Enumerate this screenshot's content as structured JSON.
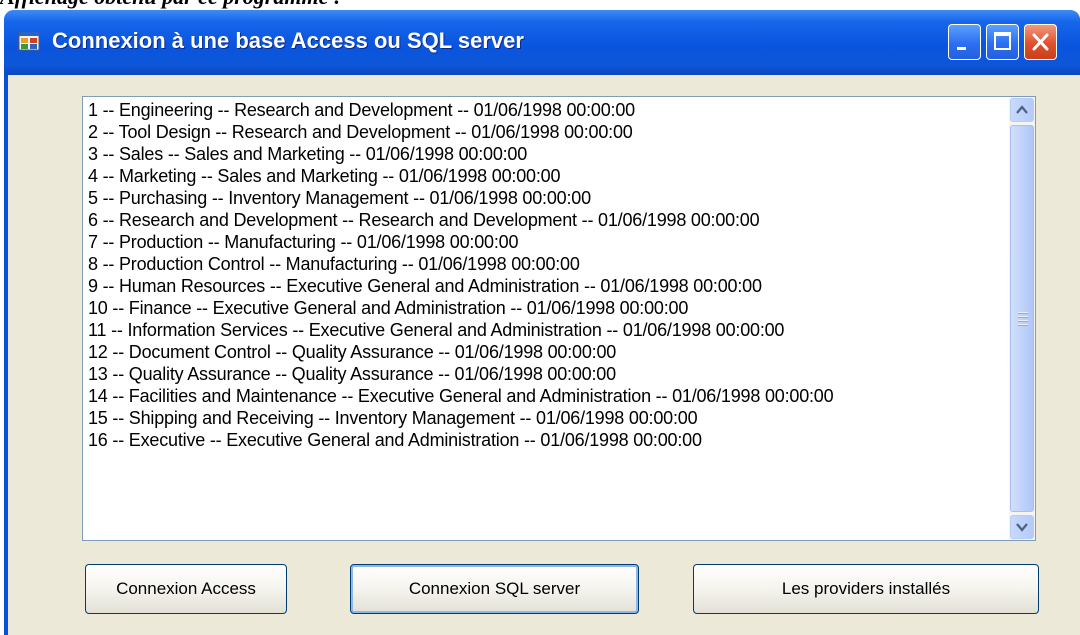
{
  "caption": "Affichage obtenu par ce programme :",
  "window": {
    "title": "Connexion à une base Access ou SQL server",
    "icon": "app-window-icon",
    "controls": [
      "minimize-icon",
      "maximize-icon",
      "close-icon"
    ]
  },
  "list": {
    "items": [
      "1 -- Engineering -- Research and Development -- 01/06/1998 00:00:00",
      "2 -- Tool Design -- Research and Development -- 01/06/1998 00:00:00",
      "3 -- Sales -- Sales and Marketing -- 01/06/1998 00:00:00",
      "4 -- Marketing -- Sales and Marketing -- 01/06/1998 00:00:00",
      "5 -- Purchasing -- Inventory Management -- 01/06/1998 00:00:00",
      "6 -- Research and Development -- Research and Development -- 01/06/1998 00:00:00",
      "7 -- Production -- Manufacturing -- 01/06/1998 00:00:00",
      "8 -- Production Control -- Manufacturing -- 01/06/1998 00:00:00",
      "9 -- Human Resources -- Executive General and Administration -- 01/06/1998 00:00:00",
      "10 -- Finance -- Executive General and Administration -- 01/06/1998 00:00:00",
      "11 -- Information Services -- Executive General and Administration -- 01/06/1998 00:00:00",
      "12 -- Document Control -- Quality Assurance -- 01/06/1998 00:00:00",
      "13 -- Quality Assurance -- Quality Assurance -- 01/06/1998 00:00:00",
      "14 -- Facilities and Maintenance -- Executive General and Administration -- 01/06/1998 00:00:00",
      "15 -- Shipping and Receiving -- Inventory Management -- 01/06/1998 00:00:00",
      "16 -- Executive -- Executive General and Administration -- 01/06/1998 00:00:00"
    ]
  },
  "buttons": {
    "access": "Connexion Access",
    "sqlserver": "Connexion SQL server",
    "providers": "Les providers installés"
  },
  "colors": {
    "titlebar": "#0a55df",
    "client": "#ece9d8",
    "close": "#e0502c"
  }
}
